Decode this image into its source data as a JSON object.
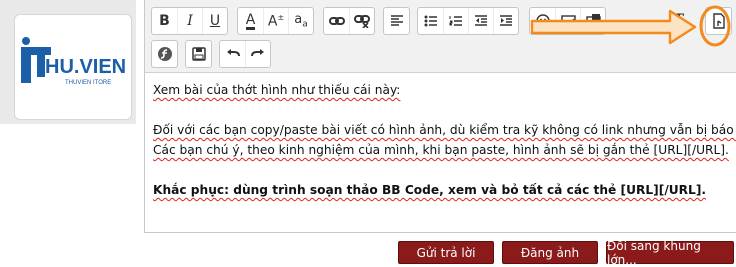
{
  "logo": {
    "text_it": "it",
    "text_main": "HU.VIEN",
    "text_sub": "THUVIEN ITORE"
  },
  "toolbar": {
    "row1": [
      {
        "name": "bold-button",
        "glyph": "B"
      },
      {
        "name": "italic-button",
        "glyph": "I"
      },
      {
        "name": "underline-button",
        "glyph": "U"
      },
      {
        "name": "font-color-button",
        "glyph": "A"
      },
      {
        "name": "font-size-button",
        "glyph": "A"
      },
      {
        "name": "font-family-button",
        "glyph": "a"
      },
      {
        "name": "link-button",
        "glyph": "link-icon"
      },
      {
        "name": "unlink-button",
        "glyph": "unlink-icon"
      },
      {
        "name": "align-button",
        "glyph": "align-left-icon"
      },
      {
        "name": "bulleted-list-button",
        "glyph": "bullet-list-icon"
      },
      {
        "name": "numbered-list-button",
        "glyph": "numbered-list-icon"
      },
      {
        "name": "outdent-button",
        "glyph": "outdent-icon"
      },
      {
        "name": "indent-button",
        "glyph": "indent-icon"
      },
      {
        "name": "smilie-button",
        "glyph": "smile-icon"
      },
      {
        "name": "image-button",
        "glyph": "image-icon"
      },
      {
        "name": "media-button",
        "glyph": "media-icon"
      },
      {
        "name": "remove-format-button",
        "glyph": "T"
      },
      {
        "name": "toggle-bbcode-button",
        "glyph": "bbcode-toggle-icon"
      }
    ],
    "row2": [
      {
        "name": "flash-button",
        "glyph": "flash-icon"
      },
      {
        "name": "save-draft-button",
        "glyph": "floppy-icon"
      },
      {
        "name": "undo-button",
        "glyph": "undo-icon"
      },
      {
        "name": "redo-button",
        "glyph": "redo-icon"
      }
    ]
  },
  "content": {
    "line1": "Xem bài của thớt hình như thiếu cái này:",
    "line2": "Đối với các bạn copy/paste bài viết có hình ảnh, dù kiểm tra kỹ không có link nhưng vẫn bị báo lỗi.",
    "line3": "Các bạn chú ý, theo kinh nghiệm của mình, khi bạn paste, hình ảnh sẽ bị gắn thẻ [URL][/URL].",
    "line4": "Khắc phục: dùng trình soạn thảo BB Code, xem và bỏ tất cả các thẻ [URL][/URL]."
  },
  "buttons": {
    "reply": "Gửi trả lời",
    "upload": "Đăng ảnh",
    "switch": "Đổi sang khung lớn..."
  },
  "colors": {
    "button_bg": "#8b1a1a",
    "annotation": "#f28a1e",
    "logo_blue": "#1b5fa8"
  }
}
